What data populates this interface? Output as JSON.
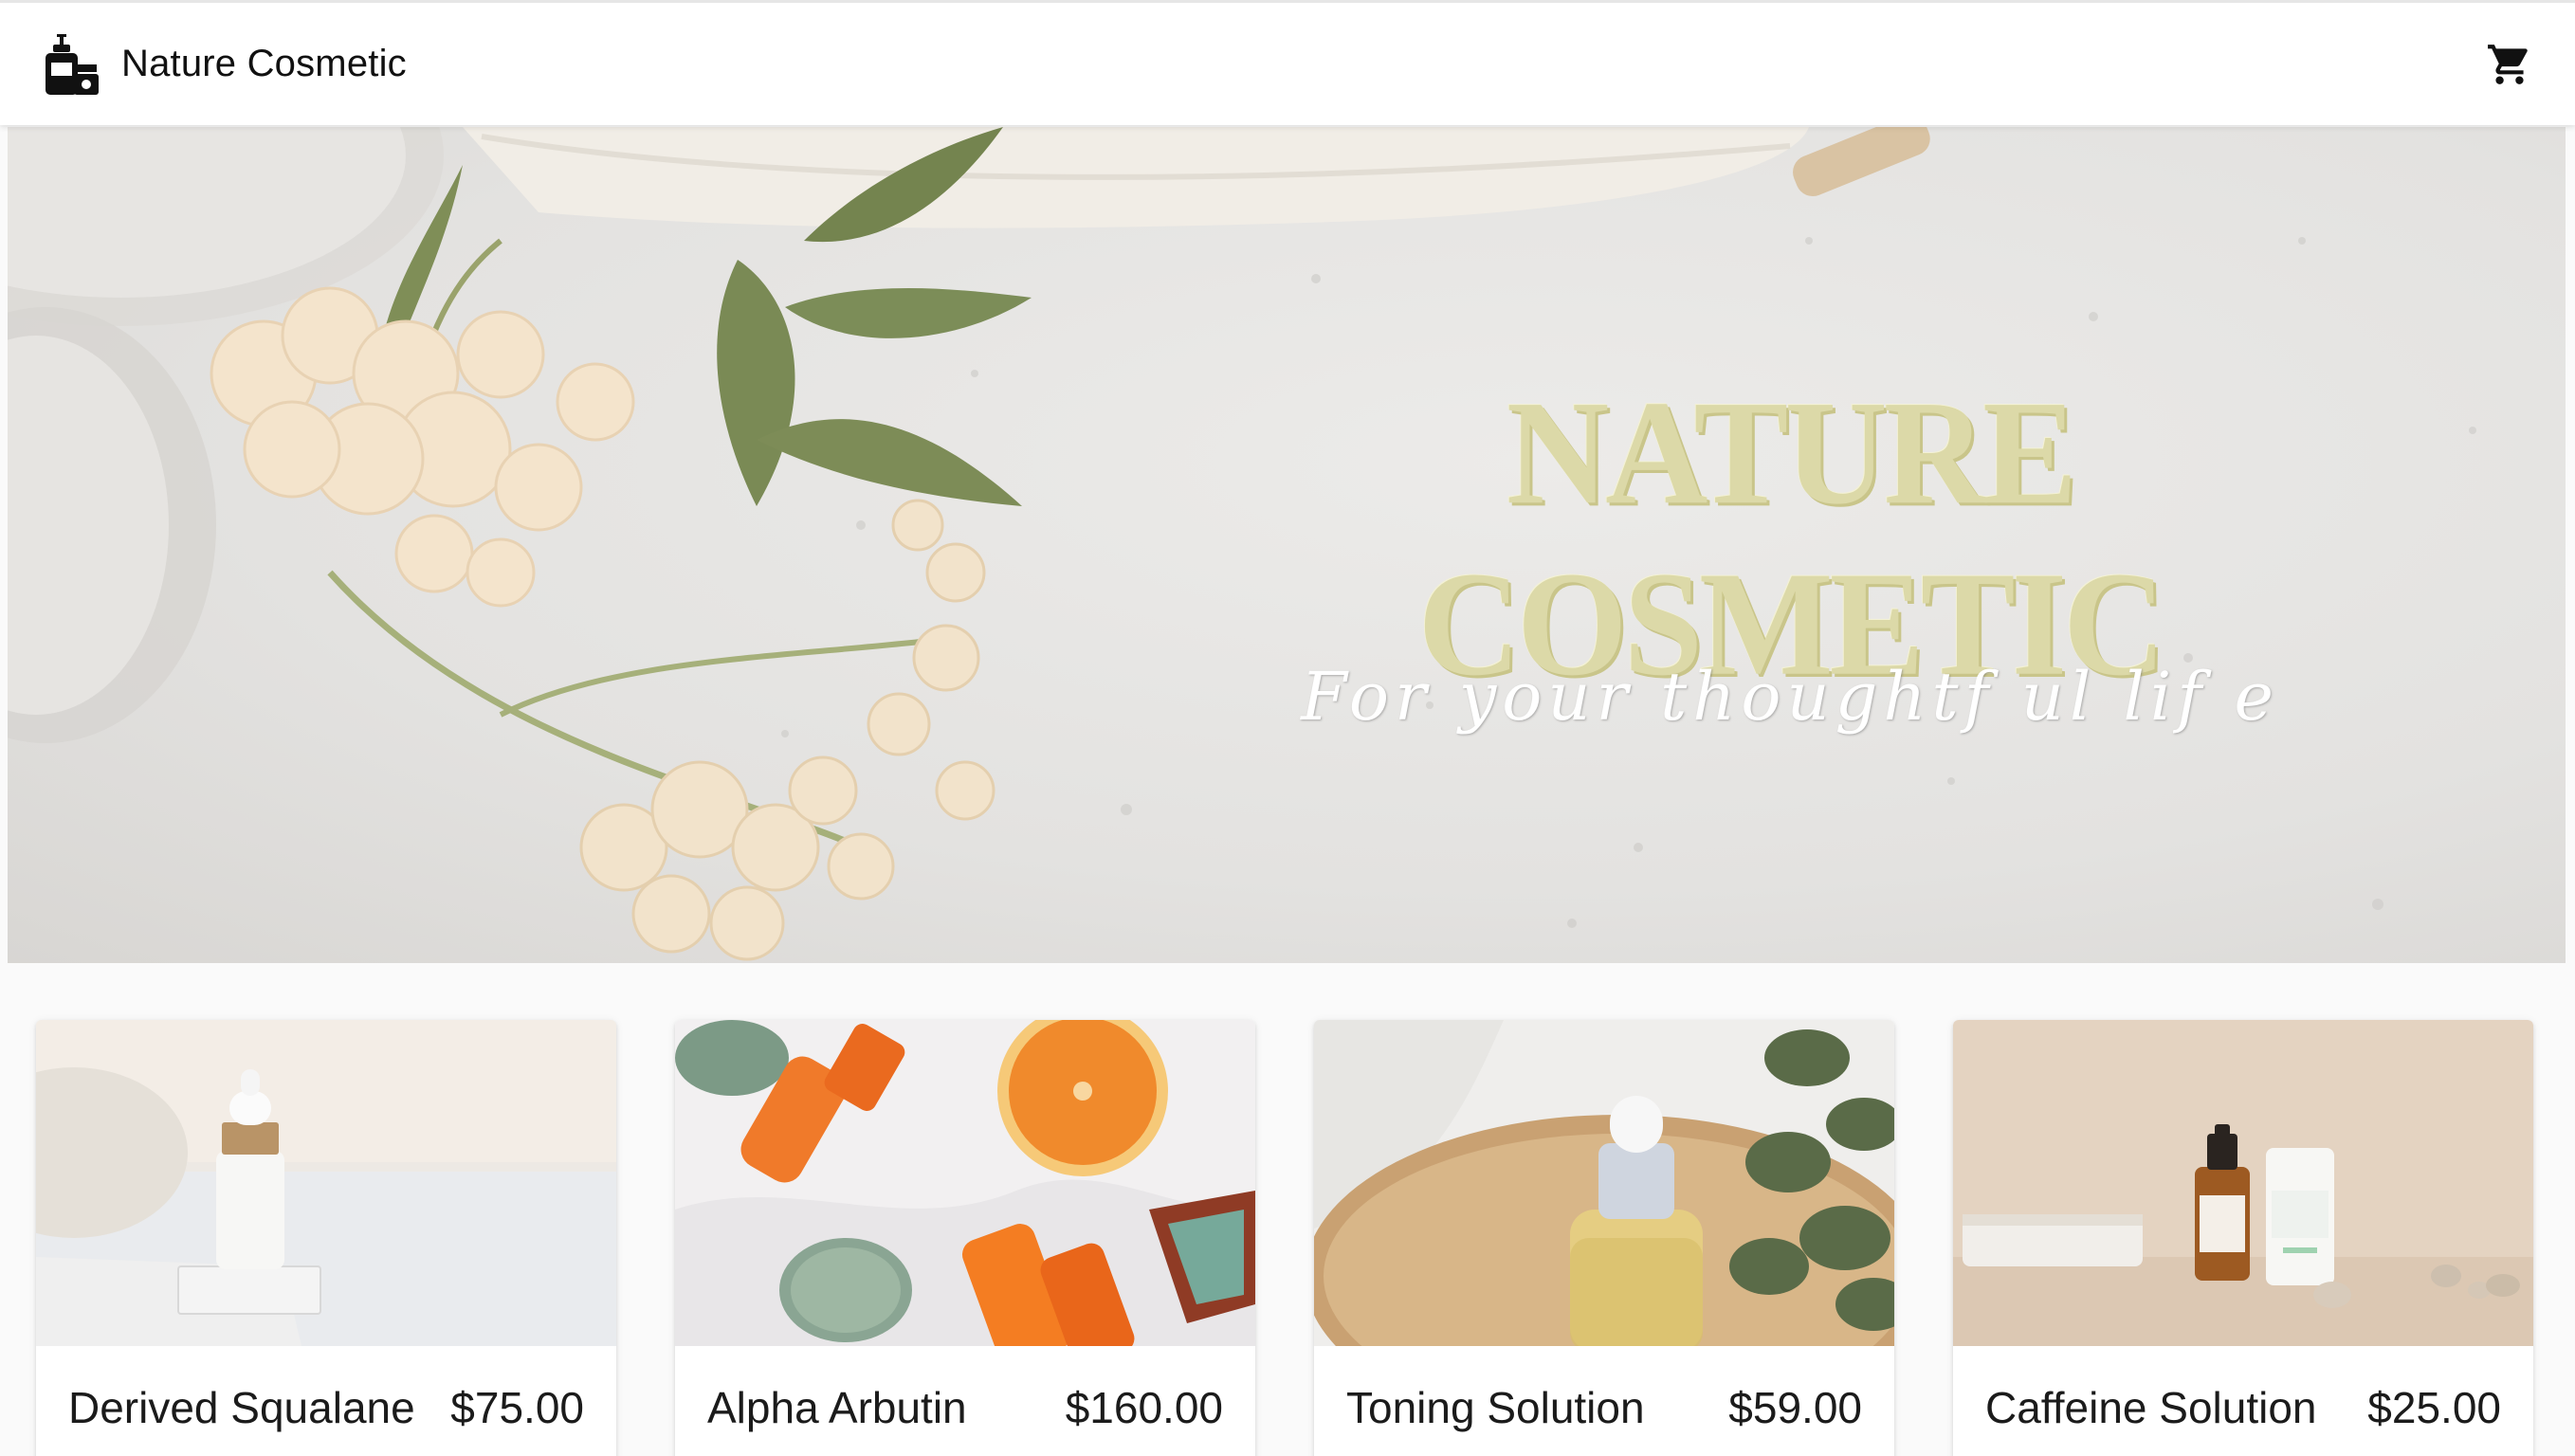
{
  "appbar": {
    "title": "Nature Cosmetic",
    "logo_icon": "cosmetics-logo-icon",
    "cart_icon": "shopping-cart-icon"
  },
  "hero": {
    "title": "NATURE COSMETIC",
    "subtitle": "For your thoughtf ul lif e"
  },
  "products": [
    {
      "name": "Derived Squalane",
      "price": "$75.00"
    },
    {
      "name": "Alpha Arbutin",
      "price": "$160.00"
    },
    {
      "name": "Toning Solution",
      "price": "$59.00"
    },
    {
      "name": "Caffeine Solution",
      "price": "$25.00"
    }
  ],
  "colors": {
    "appbar_bg": "#ffffff",
    "page_bg": "#fafafa",
    "hero_title": "#dcd9a8",
    "text": "#1f1f1f"
  }
}
